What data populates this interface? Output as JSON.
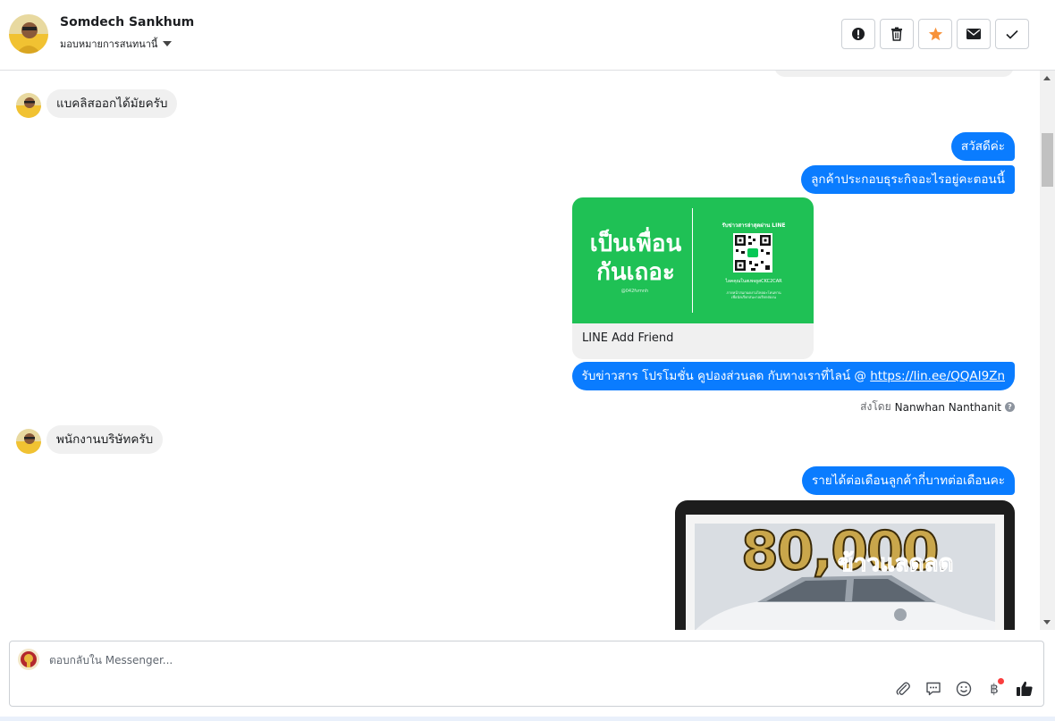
{
  "header": {
    "contact_name": "Somdech Sankhum",
    "assign_label": "มอบหมายการสนทนานี้"
  },
  "toolbar": {
    "buttons": [
      {
        "name": "spam-button",
        "icon": "exclamation-icon"
      },
      {
        "name": "delete-button",
        "icon": "trash-icon"
      },
      {
        "name": "star-button",
        "icon": "star-icon",
        "color": "#f7923a"
      },
      {
        "name": "mark-unread-button",
        "icon": "envelope-icon"
      },
      {
        "name": "done-button",
        "icon": "check-icon"
      }
    ]
  },
  "messages": [
    {
      "id": "m1",
      "direction": "in",
      "text": "แบคลิสออกได้มัยครับ"
    },
    {
      "id": "m2",
      "direction": "out",
      "text": "สวัสดีค่ะ"
    },
    {
      "id": "m3",
      "direction": "out",
      "text": "ลูกค้าประกอบธุระกิจอะไรอยู่คะตอนนี้"
    },
    {
      "id": "m4",
      "direction": "out",
      "type": "card",
      "caption": "LINE Add Friend",
      "card_title_line1": "เป็นเพื่อน",
      "card_title_line2": "กันเถอะ",
      "card_handle": "@042fvmnh",
      "card_right_title": "รับข่าวสารล่าสุดผ่าน LINE",
      "card_right_sub": "ไลคคุณในสเพจยูสCKC2CAR",
      "card_right_note": "ภายหน้าสแกนดงามไหลอะโหนทาน\nเพื่อนัลเรียกสนะกลเรียกต่องน"
    },
    {
      "id": "m5",
      "direction": "out",
      "text": "รับข่าวสาร  โปรโมชั่น คูปองส่วนลด กับทางเราที่ไลน์ @ ",
      "link": "https://lin.ee/QQAI9Zn"
    },
    {
      "id": "m6",
      "direction": "in",
      "text": "พนักงานบริษัทครับ"
    },
    {
      "id": "m7",
      "direction": "out",
      "text": "รายได้ต่อเดือนลูกค้ากี่บาทต่อเดือนคะ"
    },
    {
      "id": "m8",
      "direction": "out",
      "type": "image",
      "overlay_number": "80,000",
      "overlay_text": "ข้าวแลดลด"
    }
  ],
  "sent_by": {
    "prefix": "ส่งโดย",
    "agent": "Nanwhan Nanthanit"
  },
  "composer": {
    "placeholder": "ตอบกลับใน Messenger...",
    "icons": [
      "attachment-icon",
      "saved-reply-icon",
      "emoji-icon",
      "baht-icon",
      "like-icon"
    ],
    "baht_symbol": "฿"
  },
  "colors": {
    "outgoing_bubble": "#0a7cff",
    "incoming_bubble": "#f0f0f0",
    "line_green": "#1fc155"
  }
}
